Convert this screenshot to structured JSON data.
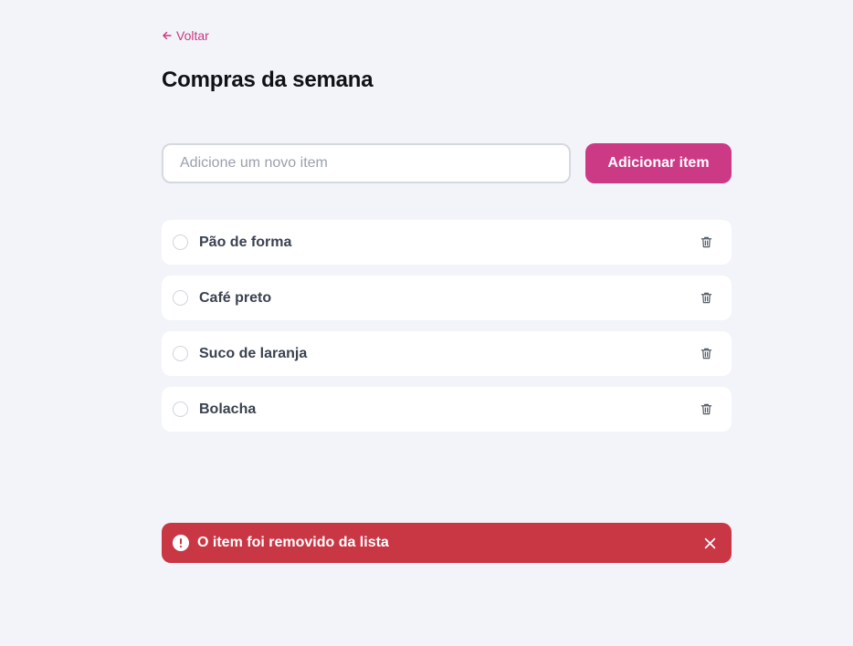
{
  "nav": {
    "back_label": "Voltar",
    "back_icon": "arrow-left-icon"
  },
  "page": {
    "title": "Compras da semana"
  },
  "add_form": {
    "placeholder": "Adicione um novo item",
    "value": "",
    "button_label": "Adicionar item"
  },
  "items": [
    {
      "label": "Pão de forma",
      "checked": false
    },
    {
      "label": "Café preto",
      "checked": false
    },
    {
      "label": "Suco de laranja",
      "checked": false
    },
    {
      "label": "Bolacha",
      "checked": false
    }
  ],
  "toast": {
    "message": "O item foi removido da lista",
    "icon": "alert-circle-icon",
    "close_icon": "close-icon"
  },
  "colors": {
    "accent": "#cc3a86",
    "background": "#f3f4f9",
    "toast_error": "#c93745"
  }
}
